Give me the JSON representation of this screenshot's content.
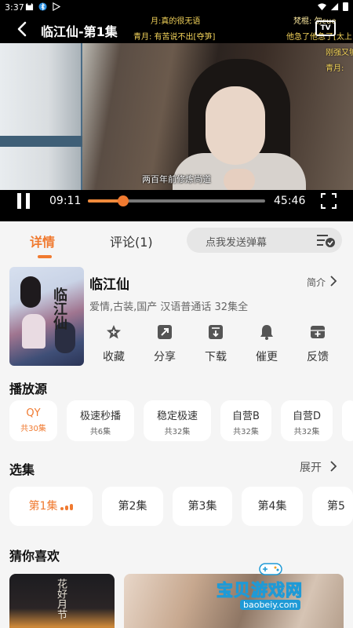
{
  "status_bar": {
    "time": "3:37"
  },
  "player": {
    "title": "临江仙-第1集",
    "tv_label": "TV",
    "subtitle": "两百年前修炼尚道",
    "current_time": "09:11",
    "total_time": "45:46",
    "progress": 0.2,
    "danmaku": [
      {
        "text": "月:真的很无语"
      },
      {
        "text": "梵棍: 勿cue"
      },
      {
        "text": "青月: 有苦说不出[夺笋]"
      },
      {
        "text": "他急了他急了[太上"
      },
      {
        "text": "刚强又够"
      },
      {
        "text": "青月:"
      }
    ]
  },
  "tabs": {
    "detail": "详情",
    "comments": "评论(1)",
    "danmu_placeholder": "点我发送弹幕"
  },
  "show": {
    "poster_title": "临江仙",
    "name": "临江仙",
    "intro_label": "简介",
    "meta": "爱情,古装,国产 汉语普通话 32集全",
    "actions": [
      {
        "label": "收藏",
        "icon": "star-add-icon"
      },
      {
        "label": "分享",
        "icon": "share-icon"
      },
      {
        "label": "下载",
        "icon": "download-icon"
      },
      {
        "label": "催更",
        "icon": "bell-icon"
      },
      {
        "label": "反馈",
        "icon": "feedback-icon"
      }
    ]
  },
  "sources": {
    "title": "播放源",
    "items": [
      {
        "name": "QY",
        "count": "共30集",
        "active": true
      },
      {
        "name": "极速秒播",
        "count": "共6集",
        "active": false
      },
      {
        "name": "稳定极速",
        "count": "共32集",
        "active": false
      },
      {
        "name": "自营B",
        "count": "共32集",
        "active": false
      },
      {
        "name": "自营D",
        "count": "共32集",
        "active": false
      }
    ]
  },
  "episodes": {
    "title": "选集",
    "expand_label": "展开",
    "items": [
      "第1集",
      "第2集",
      "第3集",
      "第4集",
      "第5"
    ]
  },
  "recommend": {
    "title": "猜你喜欢",
    "items": [
      {
        "poster_text": "花好月节"
      },
      {
        "poster_text": ""
      }
    ]
  },
  "watermark": {
    "text": "宝贝游戏网",
    "url": "baobeiy.com"
  },
  "colors": {
    "accent": "#f07a30",
    "danmaku": "#f3d35a"
  }
}
